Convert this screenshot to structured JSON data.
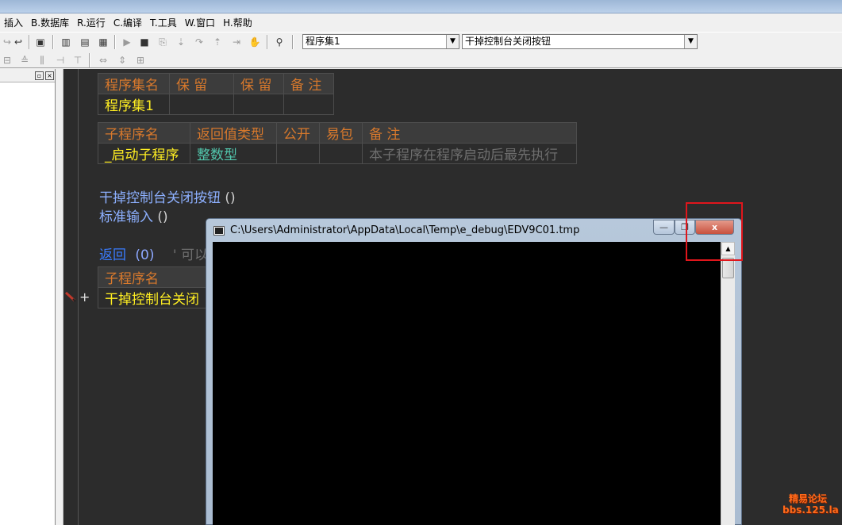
{
  "menubar": {
    "items": [
      "插入",
      "B.数据库",
      "R.运行",
      "C.编译",
      "T.工具",
      "W.窗口",
      "H.帮助"
    ]
  },
  "toolbar": {
    "program_set_combo": "程序集1",
    "subprogram_combo": "干掉控制台关闭按钮"
  },
  "editor": {
    "set_table": {
      "headers": [
        "程序集名",
        "保 留",
        "保 留",
        "备 注"
      ],
      "row": [
        "程序集1",
        "",
        "",
        ""
      ]
    },
    "sub_table": {
      "headers": [
        "子程序名",
        "返回值类型",
        "公开",
        "易包",
        "备 注"
      ],
      "row": [
        "_启动子程序",
        "整数型",
        "",
        "",
        "本子程序在程序启动后最先执行"
      ]
    },
    "lines": {
      "line1_name": "干掉控制台关闭按钮",
      "line1_args": "()",
      "line2_name": "标准输入",
      "line2_args": "()",
      "line3_keyword": "返回",
      "line3_args": "(0)",
      "line3_comment": "' 可以"
    },
    "sub_table2": {
      "header": "子程序名",
      "row": "干掉控制台关闭"
    },
    "gutter_plus": "+"
  },
  "console": {
    "title": "C:\\Users\\Administrator\\AppData\\Local\\Temp\\e_debug\\EDV9C01.tmp",
    "min_label": "—",
    "max_label": "❐",
    "close_label": "x"
  },
  "watermark": {
    "line1": "精易论坛",
    "line2": "bbs.125.la"
  },
  "colors": {
    "editor_bg": "#2c2c2c",
    "header_text": "#d8792c",
    "highlight_box": "#e0161c"
  }
}
